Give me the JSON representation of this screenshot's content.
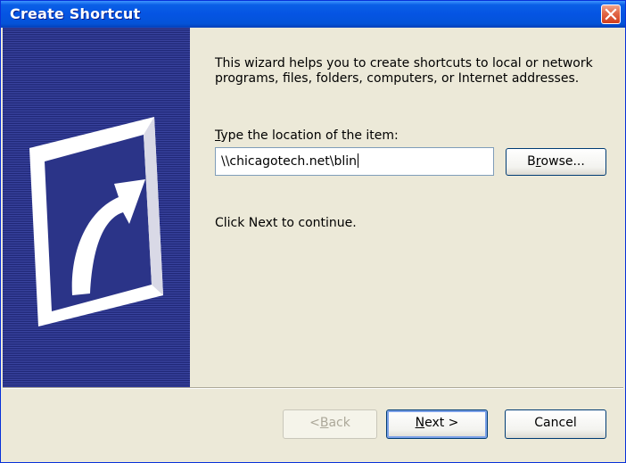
{
  "window": {
    "title": "Create Shortcut"
  },
  "body": {
    "intro": "This wizard helps you to create shortcuts to local or network programs, files, folders, computers, or Internet addresses.",
    "location_label_mnemonic": "T",
    "location_label_rest": "ype the location of the item:",
    "location_value": "\\\\chicagotech.net\\blin",
    "browse_mnemonic": "r",
    "browse_pre": "B",
    "browse_post": "owse...",
    "continue_text": "Click Next to continue."
  },
  "buttons": {
    "back_pre": "< ",
    "back_mnemonic": "B",
    "back_post": "ack",
    "next_mnemonic": "N",
    "next_post": "ext >",
    "cancel": "Cancel"
  },
  "icons": {
    "close": "close-icon",
    "banner": "shortcut-arrow-icon"
  },
  "colors": {
    "titlebar": "#0554e3",
    "banner": "#2b3488",
    "dialog": "#ece9d8",
    "close": "#d23d1c"
  }
}
